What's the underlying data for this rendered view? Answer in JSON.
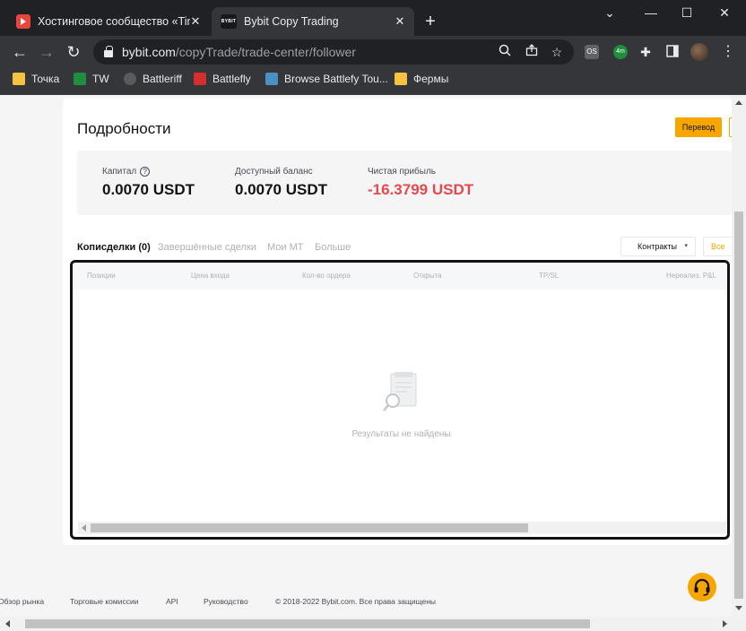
{
  "browser": {
    "tabs": [
      {
        "title": "Хостинговое сообщество «Time",
        "active": false
      },
      {
        "title": "Bybit Copy Trading",
        "active": true,
        "favicon_text": "BYBIT"
      }
    ],
    "new_tab_symbol": "+",
    "window_controls": [
      "⌄",
      "—",
      "☐",
      "✕"
    ],
    "url": {
      "host": "bybit.com",
      "path": "/copyTrade/trade-center/follower"
    },
    "extensions": [
      {
        "name": "os-extension-icon",
        "text": "OS",
        "color": "#5f6368"
      },
      {
        "name": "timer-extension-icon",
        "text": "4m",
        "color": "#1e8e3e"
      }
    ],
    "bookmarks": [
      {
        "label": "Точка",
        "icon": "folder-icon"
      },
      {
        "label": "TW",
        "icon": "tw-icon"
      },
      {
        "label": "Battleriff",
        "icon": "battleriff-icon"
      },
      {
        "label": "Battlefly",
        "icon": "battlefly-icon"
      },
      {
        "label": "Browse Battlefy Tou...",
        "icon": "battlefy-icon"
      },
      {
        "label": "Фермы",
        "icon": "folder-icon"
      }
    ]
  },
  "page": {
    "title": "Подробности",
    "transfer_button": "Перевод",
    "summary": {
      "capital_label": "Капитал",
      "capital_value": "0.0070 USDT",
      "balance_label": "Доступный баланс",
      "balance_value": "0.0070 USDT",
      "profit_label": "Чистая прибыль",
      "profit_value": "-16.3799 USDT"
    },
    "tabs": [
      "Кописделки (0)",
      "Завершённые сделки",
      "Мои МТ",
      "Больше"
    ],
    "contracts_dropdown": "Контракты",
    "all_dropdown": "Все",
    "table": {
      "columns": [
        "Позиции",
        "Цена входа",
        "Кол-во ордера",
        "Открыта",
        "TP/SL",
        "Нереализ. P&L"
      ],
      "empty_text": "Результаты не найдены"
    },
    "footer": [
      "Обзор рынка",
      "Торговые комиссии",
      "API",
      "Руководство",
      "© 2018-2022 Bybit.com. Все права защищены"
    ]
  },
  "colors": {
    "accent": "#f7a600",
    "negative": "#e5484d",
    "highlight_border": "#121214"
  }
}
